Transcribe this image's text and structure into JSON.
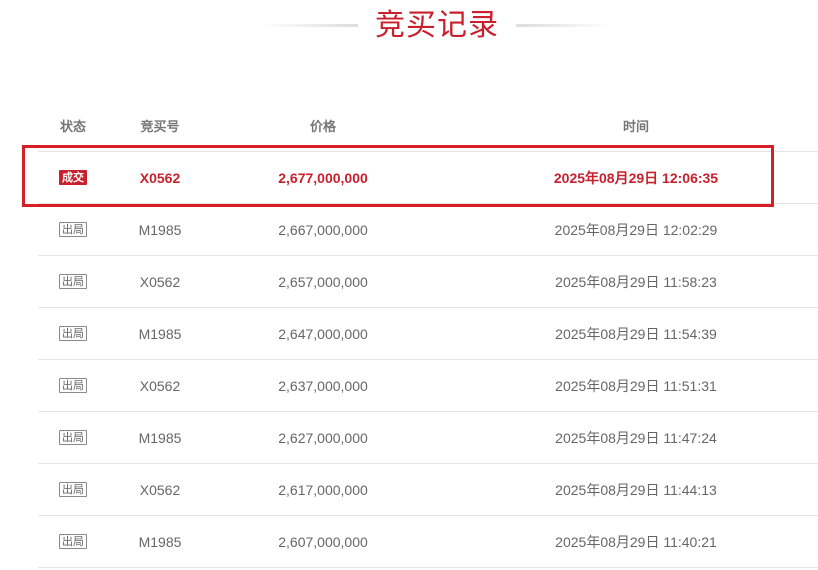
{
  "page_title": "竞买记录",
  "colors": {
    "accent": "#c8202d",
    "highlight_border": "#d61f26"
  },
  "table": {
    "headers": {
      "status": "状态",
      "bidder": "竞买号",
      "price": "价格",
      "time": "时间"
    },
    "rows": [
      {
        "status": "成交",
        "bidder": "X0562",
        "price": "2,677,000,000",
        "time": "2025年08月29日 12:06:35"
      },
      {
        "status": "出局",
        "bidder": "M1985",
        "price": "2,667,000,000",
        "time": "2025年08月29日 12:02:29"
      },
      {
        "status": "出局",
        "bidder": "X0562",
        "price": "2,657,000,000",
        "time": "2025年08月29日 11:58:23"
      },
      {
        "status": "出局",
        "bidder": "M1985",
        "price": "2,647,000,000",
        "time": "2025年08月29日 11:54:39"
      },
      {
        "status": "出局",
        "bidder": "X0562",
        "price": "2,637,000,000",
        "time": "2025年08月29日 11:51:31"
      },
      {
        "status": "出局",
        "bidder": "M1985",
        "price": "2,627,000,000",
        "time": "2025年08月29日 11:47:24"
      },
      {
        "status": "出局",
        "bidder": "X0562",
        "price": "2,617,000,000",
        "time": "2025年08月29日 11:44:13"
      },
      {
        "status": "出局",
        "bidder": "M1985",
        "price": "2,607,000,000",
        "time": "2025年08月29日 11:40:21"
      }
    ]
  }
}
